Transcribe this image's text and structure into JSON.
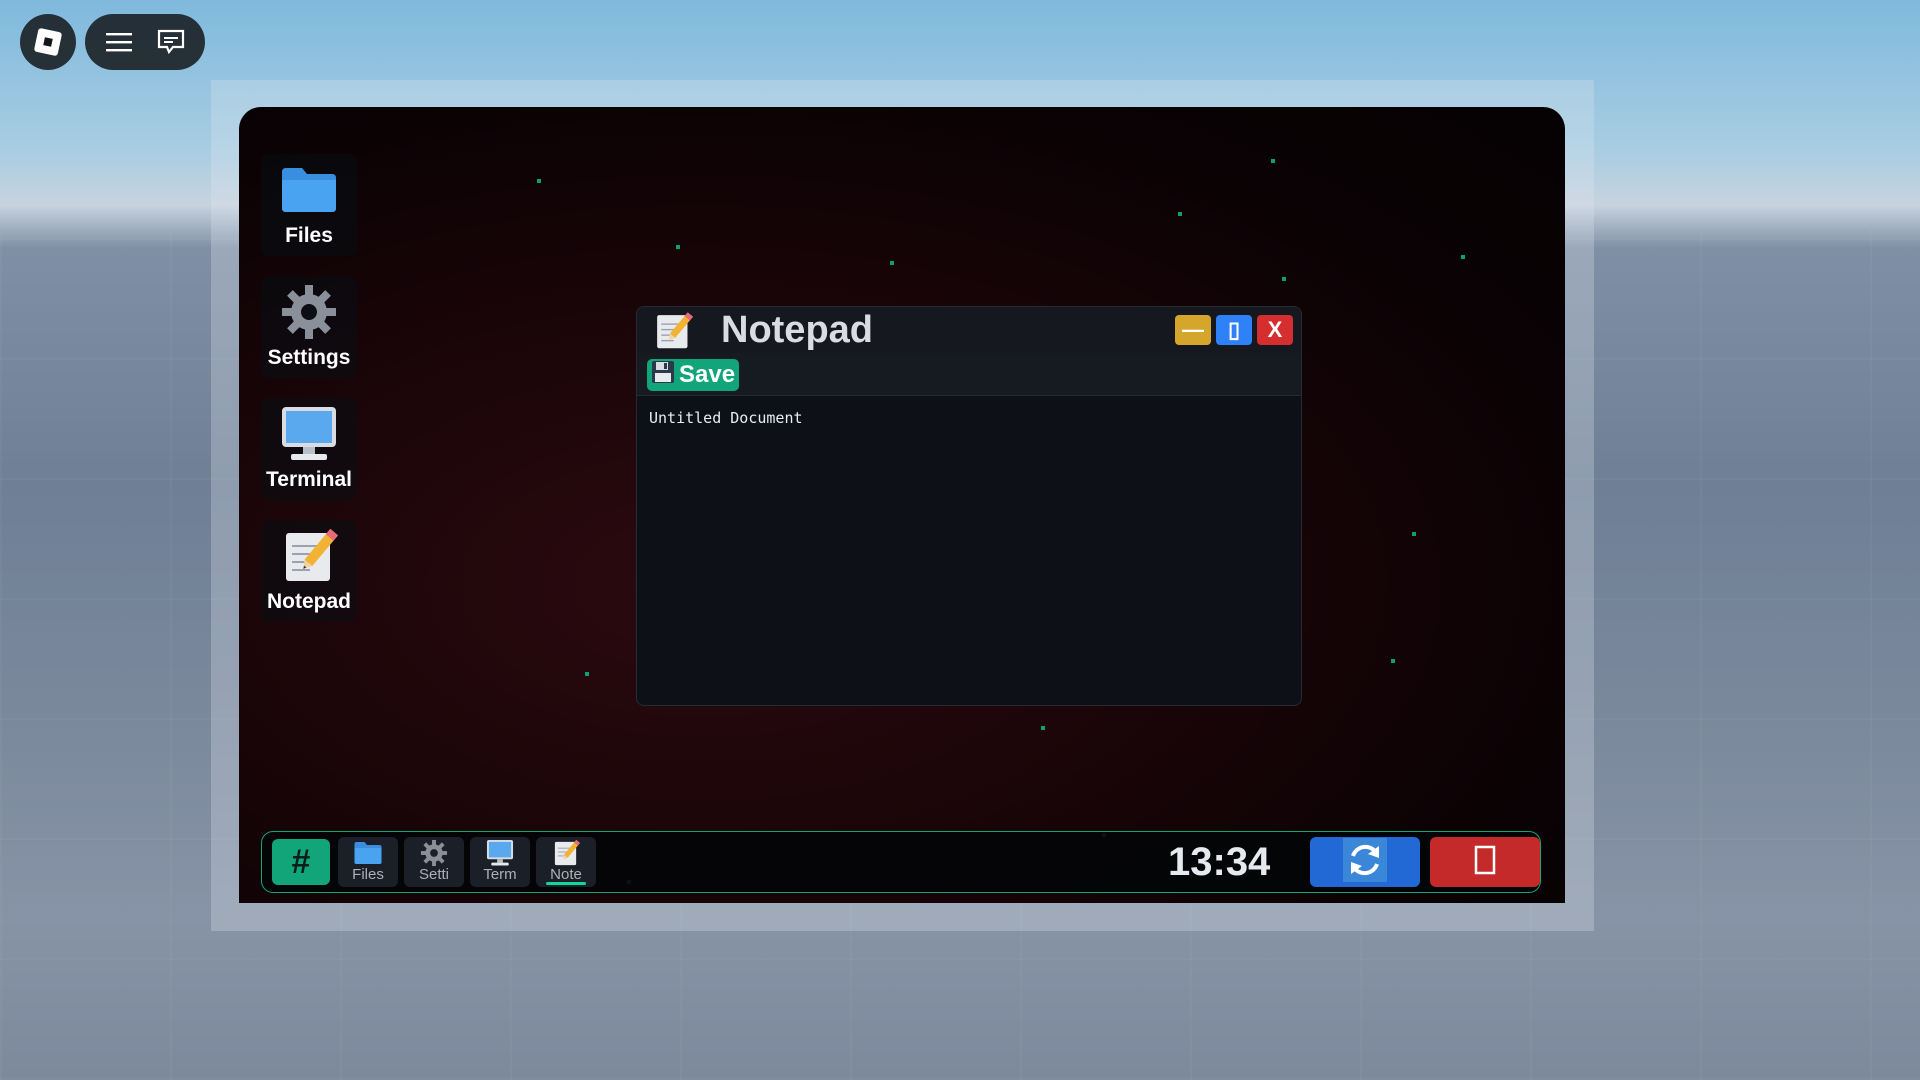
{
  "roblox": {
    "logo_icon": "roblox-logo-icon",
    "menu_icon": "hamburger-menu-icon",
    "chat_icon": "chat-icon"
  },
  "desktop": {
    "icons": [
      {
        "label": "Files",
        "icon": "folder-icon"
      },
      {
        "label": "Settings",
        "icon": "gear-icon"
      },
      {
        "label": "Terminal",
        "icon": "monitor-icon"
      },
      {
        "label": "Notepad",
        "icon": "notepad-icon"
      }
    ]
  },
  "notepad": {
    "title": "Notepad",
    "minimize_label": "—",
    "maximize_label": "▯",
    "close_label": "X",
    "save_label": "Save",
    "content": "Untitled Document"
  },
  "taskbar": {
    "start_label": "#",
    "apps": [
      {
        "label": "Files",
        "icon": "folder-icon"
      },
      {
        "label": "Setti",
        "icon": "gear-icon"
      },
      {
        "label": "Term",
        "icon": "monitor-icon"
      },
      {
        "label": "Note",
        "icon": "notepad-icon",
        "active": true
      }
    ],
    "clock": "13:34",
    "restart_icon": "refresh-icon",
    "power_icon": "power-icon"
  },
  "colors": {
    "accent": "#13a57a",
    "minimize": "#d4a72c",
    "maximize": "#2f81f7",
    "close": "#d42e2e",
    "restart": "#2369d6",
    "power": "#c42a2a"
  }
}
